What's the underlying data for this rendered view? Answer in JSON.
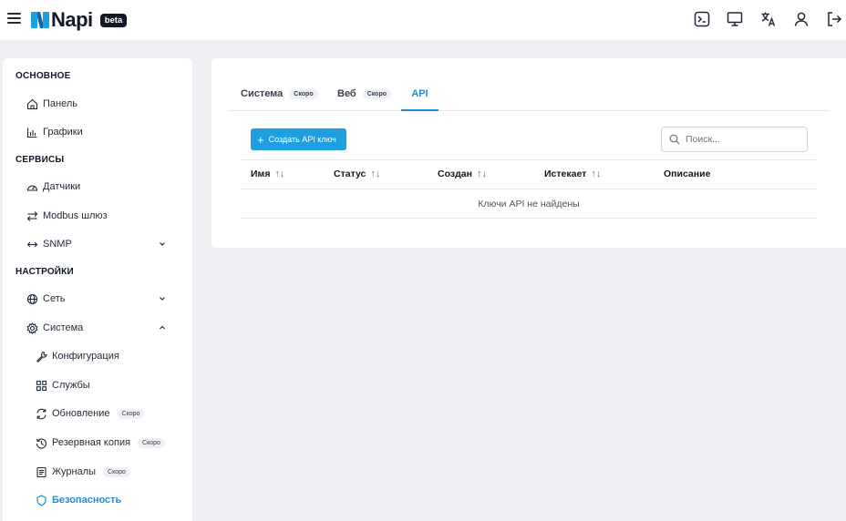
{
  "header": {
    "logo_text": "Napi",
    "badge": "beta",
    "icons": [
      "terminal-icon",
      "monitor-icon",
      "translate-icon",
      "user-icon",
      "logout-icon"
    ]
  },
  "sidebar": {
    "sections": [
      {
        "title": "ОСНОВНОЕ"
      },
      {
        "title": "СЕРВИСЫ"
      },
      {
        "title": "НАСТРОЙКИ"
      }
    ],
    "items": [
      {
        "label": "Панель",
        "icon": "home-icon"
      },
      {
        "label": "Графики",
        "icon": "bar-chart-icon"
      },
      {
        "label": "Датчики",
        "icon": "gauge-icon"
      },
      {
        "label": "Modbus шлюз",
        "icon": "arrows-exchange-icon"
      },
      {
        "label": "SNMP",
        "icon": "arrows-horizontal-icon"
      },
      {
        "label": "Сеть",
        "icon": "globe-icon"
      },
      {
        "label": "Система",
        "icon": "gear-icon"
      },
      {
        "label": "Конфигурация",
        "icon": "wrench-icon"
      },
      {
        "label": "Службы",
        "icon": "grid-icon"
      },
      {
        "label": "Обновление",
        "icon": "refresh-icon",
        "badge": "Скоро"
      },
      {
        "label": "Резервная копия",
        "icon": "history-icon",
        "badge": "Скоро"
      },
      {
        "label": "Журналы",
        "icon": "log-icon",
        "badge": "Скоро"
      },
      {
        "label": "Безопасность",
        "icon": "shield-icon"
      }
    ]
  },
  "tabs": [
    {
      "label": "Система",
      "badge": "Скоро"
    },
    {
      "label": "Веб",
      "badge": "Скоро"
    },
    {
      "label": "API"
    }
  ],
  "toolbar": {
    "create_label": "Создать API ключ",
    "search_placeholder": "Поиск..."
  },
  "table": {
    "columns": [
      "Имя",
      "Статус",
      "Создан",
      "Истекает",
      "Описание"
    ],
    "empty_text": "Ключи API не найдены"
  },
  "colors": {
    "accent": "#1d8fd8",
    "button": "#1e9fe0",
    "background": "#eef0f3"
  }
}
